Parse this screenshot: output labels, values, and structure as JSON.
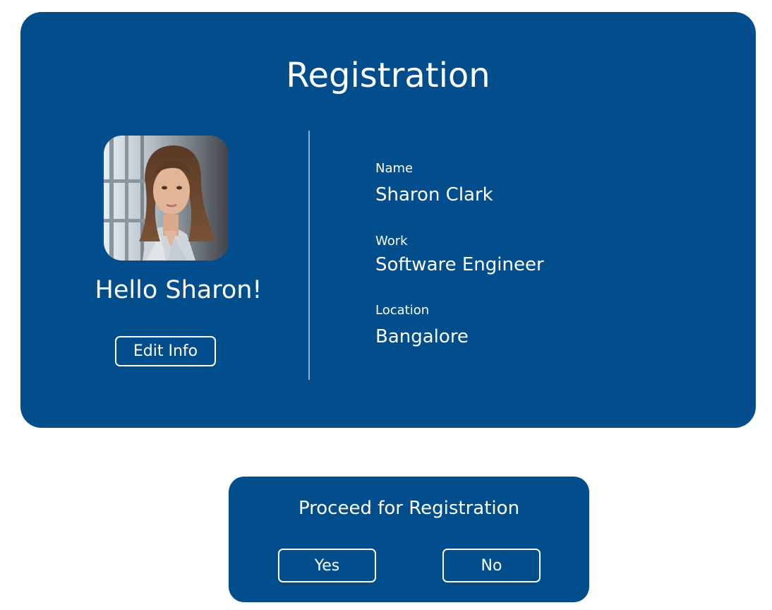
{
  "colors": {
    "card_background": "#024d8b",
    "text": "#ffffff",
    "divider": "#8fb0d2"
  },
  "registration": {
    "title": "Registration",
    "avatar_icon": "profile-photo",
    "greeting": "Hello Sharon!",
    "edit_button_label": "Edit Info",
    "fields": {
      "name": {
        "label": "Name",
        "value": "Sharon Clark"
      },
      "work": {
        "label": "Work",
        "value": "Software Engineer"
      },
      "location": {
        "label": "Location",
        "value": "Bangalore"
      }
    }
  },
  "dialog": {
    "title": "Proceed for Registration",
    "yes_label": "Yes",
    "no_label": "No"
  }
}
